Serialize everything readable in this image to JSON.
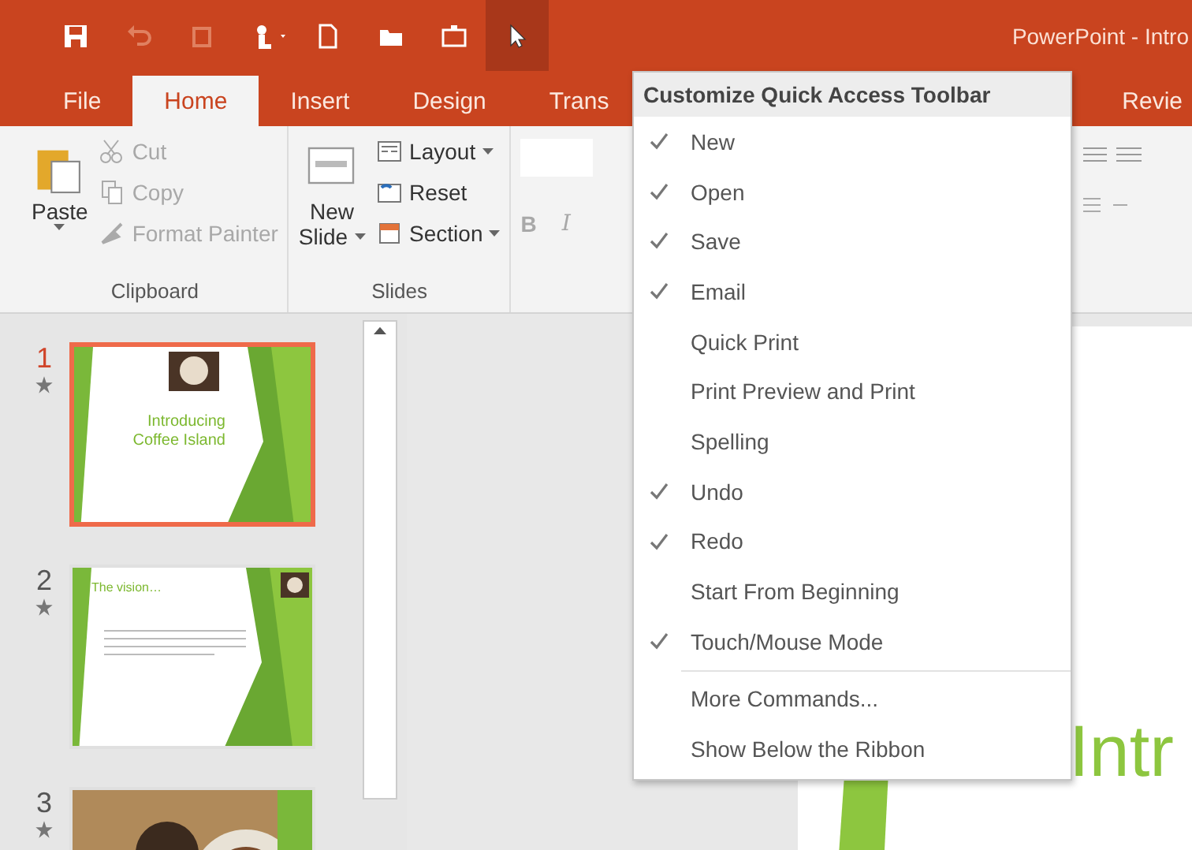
{
  "title_bar": {
    "title": "PowerPoint - Intro"
  },
  "tabs": [
    {
      "label": "File",
      "selected": false
    },
    {
      "label": "Home",
      "selected": true
    },
    {
      "label": "Insert",
      "selected": false
    },
    {
      "label": "Design",
      "selected": false
    },
    {
      "label": "Trans",
      "selected": false
    },
    {
      "label": "Revie",
      "selected": false
    }
  ],
  "ribbon": {
    "clipboard": {
      "paste": "Paste",
      "cut": "Cut",
      "copy": "Copy",
      "format_painter": "Format Painter",
      "label": "Clipboard"
    },
    "slides": {
      "new_slide_1": "New",
      "new_slide_2": "Slide",
      "layout": "Layout",
      "reset": "Reset",
      "section": "Section",
      "label": "Slides"
    },
    "font": {
      "bold": "B",
      "italic": "I"
    }
  },
  "thumbnails": [
    {
      "number": "1",
      "selected": true,
      "title": "Introducing Coffee Island"
    },
    {
      "number": "2",
      "selected": false,
      "title": "The vision…"
    },
    {
      "number": "3",
      "selected": false
    }
  ],
  "slide": {
    "title": "Intr"
  },
  "menu": {
    "title": "Customize Quick Access Toolbar",
    "items": [
      {
        "kind": "check",
        "label": "New",
        "checked": true
      },
      {
        "kind": "check",
        "label": "Open",
        "checked": true
      },
      {
        "kind": "check",
        "label": "Save",
        "checked": true
      },
      {
        "kind": "check",
        "label": "Email",
        "checked": true
      },
      {
        "kind": "check",
        "label": "Quick Print",
        "checked": false
      },
      {
        "kind": "check",
        "label": "Print Preview and Print",
        "checked": false
      },
      {
        "kind": "check",
        "label": "Spelling",
        "checked": false
      },
      {
        "kind": "check",
        "label": "Undo",
        "checked": true
      },
      {
        "kind": "check",
        "label": "Redo",
        "checked": true
      },
      {
        "kind": "check",
        "label": "Start From Beginning",
        "checked": false
      },
      {
        "kind": "check",
        "label": "Touch/Mouse Mode",
        "checked": true
      },
      {
        "kind": "command",
        "label": "More Commands..."
      },
      {
        "kind": "command",
        "label": "Show Below the Ribbon"
      }
    ]
  }
}
